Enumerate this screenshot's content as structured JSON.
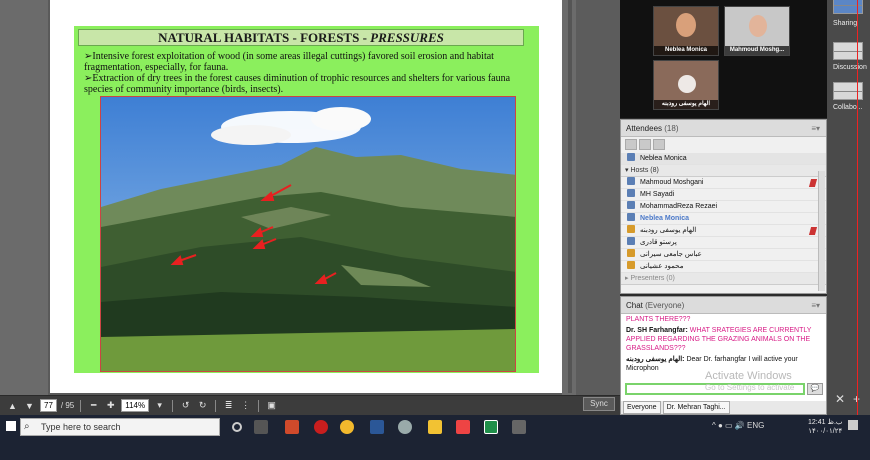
{
  "slide": {
    "title_main": "NATURAL HABITATS - FORESTS - ",
    "title_em": "PRESSURES",
    "bullet1": "➢Intensive forest exploitation of wood (in some areas illegal cuttings) favored soil erosion and habitat fragmentation, especially, for fauna.",
    "bullet2": "➢Extraction of dry trees in the forest causes diminution of trophic resources and shelters for various fauna species of community importance (birds, insects)."
  },
  "toolbar": {
    "page_current": "77",
    "page_total": "/ 95",
    "zoom": "114%",
    "sync_label": "Sync"
  },
  "video": {
    "tile1_name": "Neblea Monica",
    "tile2_name": "Mahmoud Moshg...",
    "tile3_name": "الهام یوسفی رودبنه"
  },
  "attendees": {
    "title": "Attendees",
    "count": "(18)",
    "presenter_name": "Neblea Monica",
    "hosts_label": "Hosts (8)",
    "hosts": [
      "Mahmoud Moshgani",
      "MH Sayadi",
      "MohammadReza Rezaei",
      "Neblea Monica",
      "الهام یوسفی رودبنه",
      "پرستو قادری",
      "عباس جامعی سیرانی",
      "محمود عشیانی"
    ],
    "presenters_label": "Presenters (0)"
  },
  "chat": {
    "title": "Chat",
    "scope": "(Everyone)",
    "msg0": "PLANTS THERE???",
    "msg1_author": "Dr. SH Farhangfar:",
    "msg1_text": " WHAT SRATEGIES ARE CURRENTLY APPLIED REGARDING THE GRAZING ANIMALS ON THE GRASSLANDS???",
    "msg2_author": "الهام یوسفی رودبنه:",
    "msg2_text": " Dear Dr. farhangfar I will active your Microphon",
    "tab1": "Everyone",
    "tab2": "Dr. Mehran Taghi...",
    "watermark_1": "Activate Windows",
    "watermark_2": "Go to Settings to activate"
  },
  "farright": {
    "sharing": "Sharing",
    "discussion": "Discussion",
    "collab": "Collabo..."
  },
  "taskbar": {
    "search_placeholder": "Type here to search",
    "lang": "ENG",
    "time": "12:41 ب.ظ",
    "date": "۱۴۰۰/۰۱/۲۴"
  },
  "colors": {
    "slide_bg": "#8bef5d",
    "accent_chat": "#d81b86",
    "host_highlight": "#4a78c8"
  }
}
